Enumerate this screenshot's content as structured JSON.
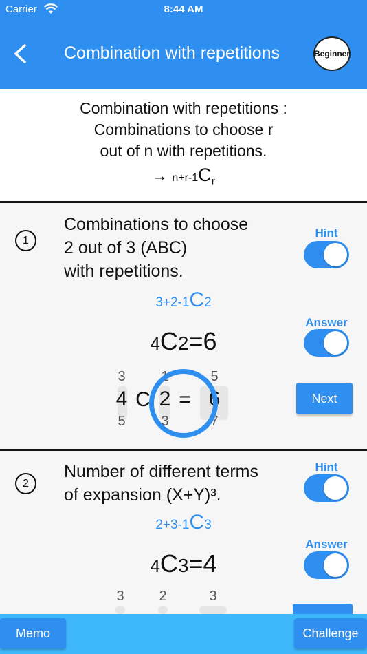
{
  "status": {
    "carrier": "Carrier",
    "time": "8:44 AM"
  },
  "appbar": {
    "title": "Combination with repetitions",
    "level": "Beginner"
  },
  "intro": {
    "line1": "Combination with repetitions :",
    "line2": "Combinations to choose r",
    "line3": "out of n with repetitions.",
    "arrow": "→",
    "sub": "n+r-1",
    "C": "C",
    "r": "r"
  },
  "q1": {
    "number": "1",
    "line1": "Combinations to choose",
    "line2": "2 out of 3 (ABC)",
    "line3": "with repetitions.",
    "hint_label": "Hint",
    "answer_label": "Answer",
    "hint_sub": "3+2-1",
    "hint_C": "C",
    "hint_r": "2",
    "ans_n": "4",
    "ans_C": "C",
    "ans_r": "2",
    "ans_eq": "=6",
    "picker": {
      "n": {
        "above": "3",
        "value": "4",
        "below": "5"
      },
      "c": "C",
      "r": {
        "above": "1",
        "value": "2",
        "below": "3"
      },
      "eq": "=",
      "res": {
        "above": "5",
        "value": "6",
        "below": "7"
      }
    },
    "next_label": "Next"
  },
  "q2": {
    "number": "2",
    "line1": "Number of different terms",
    "line2": "of expansion (X+Y)³.",
    "hint_label": "Hint",
    "answer_label": "Answer",
    "hint_sub": "2+3-1",
    "hint_C": "C",
    "hint_r": "3",
    "ans_n": "4",
    "ans_C": "C",
    "ans_r": "3",
    "ans_eq": "=4",
    "picker": {
      "n_above": "3",
      "r_above": "2",
      "res_above": "3"
    }
  },
  "bottom": {
    "memo_label": "Memo",
    "challenge_label": "Challenge"
  },
  "colors": {
    "primary": "#2f8ff0",
    "bottom_bar": "#3fb7fb"
  }
}
